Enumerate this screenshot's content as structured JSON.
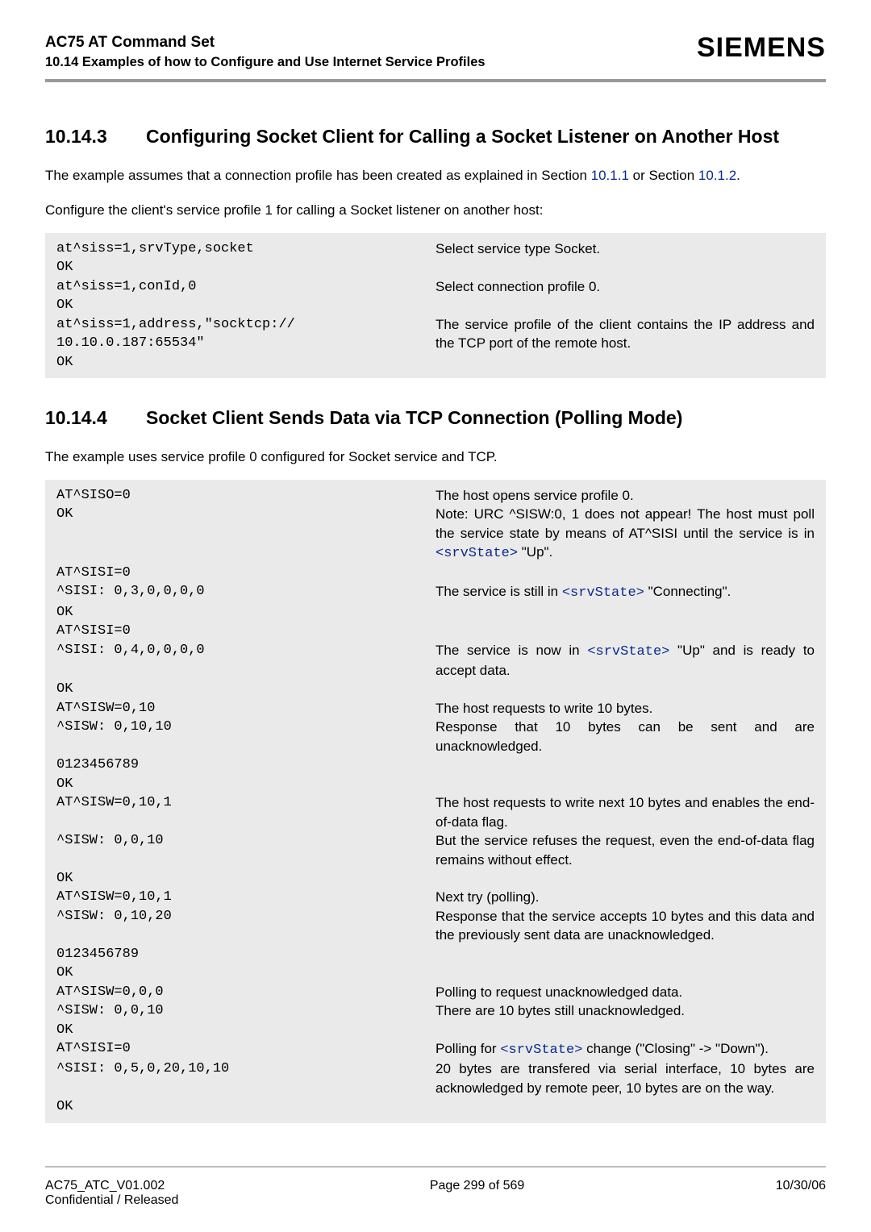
{
  "header": {
    "title": "AC75 AT Command Set",
    "subtitle": "10.14 Examples of how to Configure and Use Internet Service Profiles",
    "brand": "SIEMENS"
  },
  "sec1": {
    "num": "10.14.3",
    "title": "Configuring Socket Client for Calling a Socket Listener on Another Host",
    "para1_a": "The example assumes that a connection profile has been created as explained in Section ",
    "para1_link1": "10.1.1",
    "para1_b": " or Section ",
    "para1_link2": "10.1.2",
    "para1_c": ".",
    "para2": "Configure the client's service profile 1 for calling a Socket listener on another host:"
  },
  "block1": [
    {
      "l": "at^siss=1,srvType,socket",
      "r": "Select service type Socket."
    },
    {
      "l": "OK",
      "r": ""
    },
    {
      "l": "at^siss=1,conId,0",
      "r": "Select connection profile 0."
    },
    {
      "l": "OK",
      "r": ""
    },
    {
      "l": "at^siss=1,address,\"socktcp://\n10.10.0.187:65534\"",
      "r": "The service profile of the client contains the IP address and the TCP port of the remote host."
    },
    {
      "l": "OK",
      "r": ""
    }
  ],
  "sec2": {
    "num": "10.14.4",
    "title": "Socket Client Sends Data via TCP Connection (Polling Mode)",
    "para1": "The example uses service profile 0 configured for Socket service and TCP."
  },
  "b2": {
    "r0l": "AT^SISO=0",
    "r0r": "The host opens service profile 0.",
    "r1l": "OK",
    "r1r_a": "Note: URC ^SISW:0, 1 does not appear! The host must poll the service state by means of AT^SISI until the service is in ",
    "r1r_b": "<srvState>",
    "r1r_c": " \"Up\".",
    "r2l": "AT^SISI=0",
    "r2r": "",
    "r3l": "^SISI: 0,3,0,0,0,0",
    "r3r_a": "The service is still in ",
    "r3r_b": "<srvState>",
    "r3r_c": " \"Connecting\".",
    "r4l": "OK",
    "r4r": "",
    "r5l": "AT^SISI=0",
    "r5r": "",
    "r6l": "^SISI: 0,4,0,0,0,0",
    "r6r_a": "The service is now in ",
    "r6r_b": "<srvState>",
    "r6r_c": " \"Up\" and is ready to accept data.",
    "r7l": "OK",
    "r7r": "",
    "r8l": "AT^SISW=0,10",
    "r8r": "The host requests to write 10 bytes.",
    "r9l": "^SISW: 0,10,10",
    "r9r": "Response that 10 bytes can be sent and are unacknowledged.",
    "r10l": "0123456789",
    "r10r": "",
    "r11l": "OK",
    "r11r": "",
    "r12l": "AT^SISW=0,10,1",
    "r12r": "The host requests to write next 10 bytes and enables the end-of-data flag.",
    "r13l": "^SISW: 0,0,10",
    "r13r": "But the service refuses the request, even the end-of-data flag remains without effect.",
    "r14l": "OK",
    "r14r": "",
    "r15l": "AT^SISW=0,10,1",
    "r15r": "Next try (polling).",
    "r16l": "^SISW: 0,10,20",
    "r16r": "Response that the service accepts 10 bytes and this data and the previously sent data are unacknowledged.",
    "r17l": "0123456789",
    "r17r": "",
    "r18l": "OK",
    "r18r": "",
    "r19l": "AT^SISW=0,0,0",
    "r19r": "Polling to request unacknowledged data.",
    "r20l": "^SISW: 0,0,10",
    "r20r": "There are 10 bytes still unacknowledged.",
    "r21l": "OK",
    "r21r": "",
    "r22l": "AT^SISI=0",
    "r22r_a": "Polling for ",
    "r22r_b": "<srvState>",
    "r22r_c": " change (\"Closing\" -> \"Down\").",
    "r23l": "^SISI: 0,5,0,20,10,10",
    "r23r": "20 bytes are transfered via serial interface, 10 bytes are acknowledged by remote peer, 10 bytes are on the way.",
    "r24l": "OK",
    "r24r": ""
  },
  "footer": {
    "left1": "AC75_ATC_V01.002",
    "left2": "Confidential / Released",
    "center": "Page 299 of 569",
    "right": "10/30/06"
  }
}
